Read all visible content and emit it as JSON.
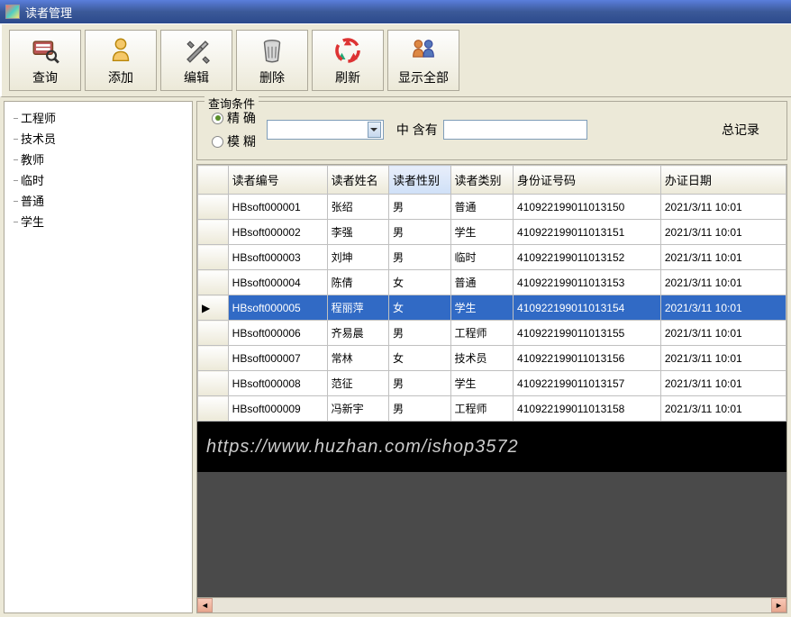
{
  "window": {
    "title": "读者管理"
  },
  "toolbar": {
    "query": "查询",
    "add": "添加",
    "edit": "编辑",
    "delete": "删除",
    "refresh": "刷新",
    "showall": "显示全部"
  },
  "tree": {
    "items": [
      "工程师",
      "技术员",
      "教师",
      "临时",
      "普通",
      "学生"
    ]
  },
  "search": {
    "legend": "查询条件",
    "radio_exact": "精 确",
    "radio_fuzzy": "模 糊",
    "combo_value": "",
    "mid_label": "中 含有",
    "text_value": "",
    "total_label": "总记录"
  },
  "grid": {
    "headers": {
      "id": "读者编号",
      "name": "读者姓名",
      "sex": "读者性别",
      "category": "读者类别",
      "pid": "身份证号码",
      "regdate": "办证日期"
    },
    "selected_index": 4,
    "rows": [
      {
        "id": "HBsoft000001",
        "name": "张绍",
        "sex": "男",
        "cat": "普通",
        "pid": "410922199011013150",
        "date": "2021/3/11 10:01"
      },
      {
        "id": "HBsoft000002",
        "name": "李强",
        "sex": "男",
        "cat": "学生",
        "pid": "410922199011013151",
        "date": "2021/3/11 10:01"
      },
      {
        "id": "HBsoft000003",
        "name": "刘坤",
        "sex": "男",
        "cat": "临时",
        "pid": "410922199011013152",
        "date": "2021/3/11 10:01"
      },
      {
        "id": "HBsoft000004",
        "name": "陈倩",
        "sex": "女",
        "cat": "普通",
        "pid": "410922199011013153",
        "date": "2021/3/11 10:01"
      },
      {
        "id": "HBsoft000005",
        "name": "程丽萍",
        "sex": "女",
        "cat": "学生",
        "pid": "410922199011013154",
        "date": "2021/3/11 10:01"
      },
      {
        "id": "HBsoft000006",
        "name": "齐易晨",
        "sex": "男",
        "cat": "工程师",
        "pid": "410922199011013155",
        "date": "2021/3/11 10:01"
      },
      {
        "id": "HBsoft000007",
        "name": "常林",
        "sex": "女",
        "cat": "技术员",
        "pid": "410922199011013156",
        "date": "2021/3/11 10:01"
      },
      {
        "id": "HBsoft000008",
        "name": "范征",
        "sex": "男",
        "cat": "学生",
        "pid": "410922199011013157",
        "date": "2021/3/11 10:01"
      },
      {
        "id": "HBsoft000009",
        "name": "冯新宇",
        "sex": "男",
        "cat": "工程师",
        "pid": "410922199011013158",
        "date": "2021/3/11 10:01"
      }
    ]
  },
  "watermark": "https://www.huzhan.com/ishop3572"
}
